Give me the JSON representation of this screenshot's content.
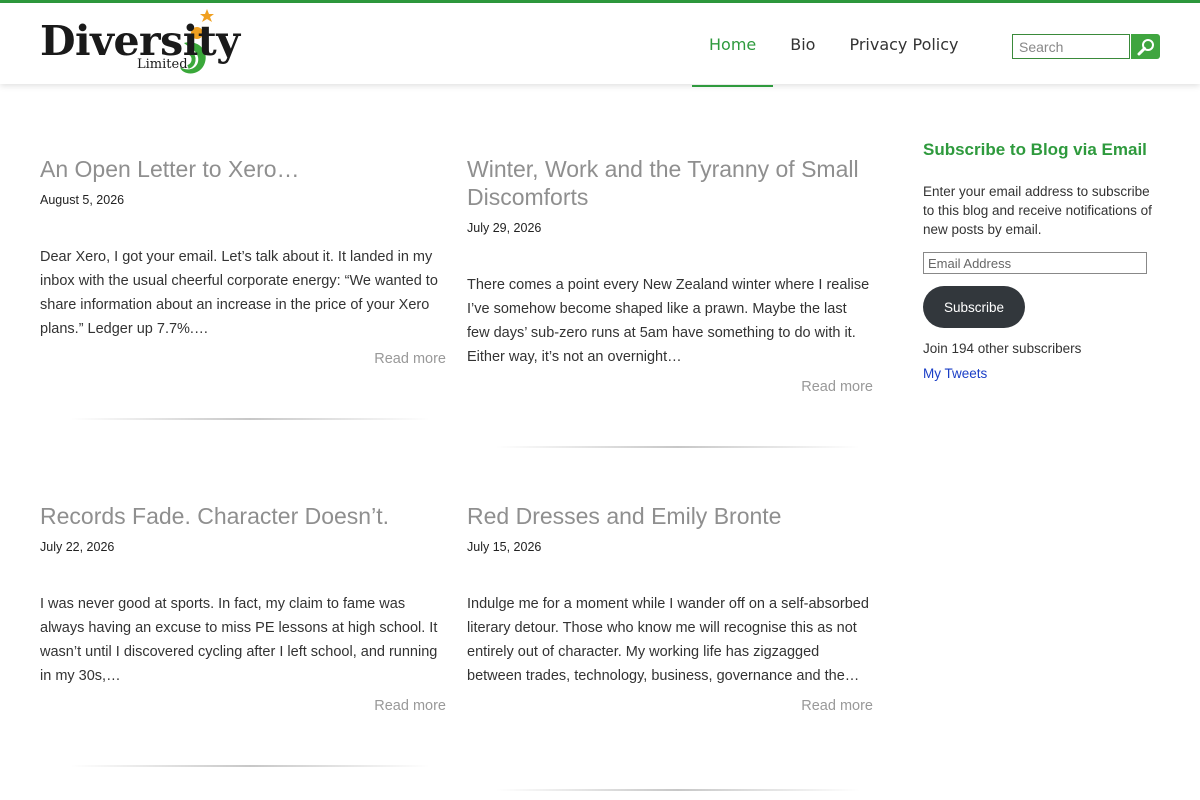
{
  "brand": {
    "logo_text": "Diversity",
    "logo_sub": "Limited",
    "accent_color": "#2e9a3d"
  },
  "nav": {
    "items": [
      {
        "label": "Home",
        "active": true
      },
      {
        "label": "Bio",
        "active": false
      },
      {
        "label": "Privacy Policy",
        "active": false
      }
    ]
  },
  "search": {
    "placeholder": "Search",
    "button_icon": "magnifier-icon"
  },
  "posts": [
    {
      "title": "An Open Letter to Xero…",
      "date": "August 5, 2026",
      "excerpt": "Dear Xero, I got your email. Let’s talk about it. It landed in my inbox with the usual cheerful corporate energy: “We wanted to share information about an increase in the price of your Xero plans.” Ledger up 7.7%.…",
      "read_more": "Read more"
    },
    {
      "title": "Winter, Work and the Tyranny of Small Discomforts",
      "date": "July 29, 2026",
      "excerpt": "There comes a point every New Zealand winter where I realise I’ve somehow become shaped like a prawn. Maybe the last few days’ sub-zero runs at 5am have something to do with it. Either way, it’s not an overnight…",
      "read_more": "Read more"
    },
    {
      "title": "Records Fade. Character Doesn’t.",
      "date": "July 22, 2026",
      "excerpt": "I was never good at sports. In fact, my claim to fame was always having an excuse to miss PE lessons at high school. It wasn’t until I discovered cycling after I left school, and running in my 30s,…",
      "read_more": "Read more"
    },
    {
      "title": "Red Dresses and Emily Bronte",
      "date": "July 15, 2026",
      "excerpt": "Indulge me for a moment while I wander off on a self-absorbed literary detour. Those who know me will recognise this as not entirely out of character. My working life has zigzagged between trades, technology, business, governance and the…",
      "read_more": "Read more"
    }
  ],
  "sidebar": {
    "widget_title": "Subscribe to Blog via Email",
    "description": "Enter your email address to subscribe to this blog and receive notifications of new posts by email.",
    "email_placeholder": "Email Address",
    "subscribe_label": "Subscribe",
    "subscriber_count": "Join 194 other subscribers",
    "tweets_link": "My Tweets"
  }
}
